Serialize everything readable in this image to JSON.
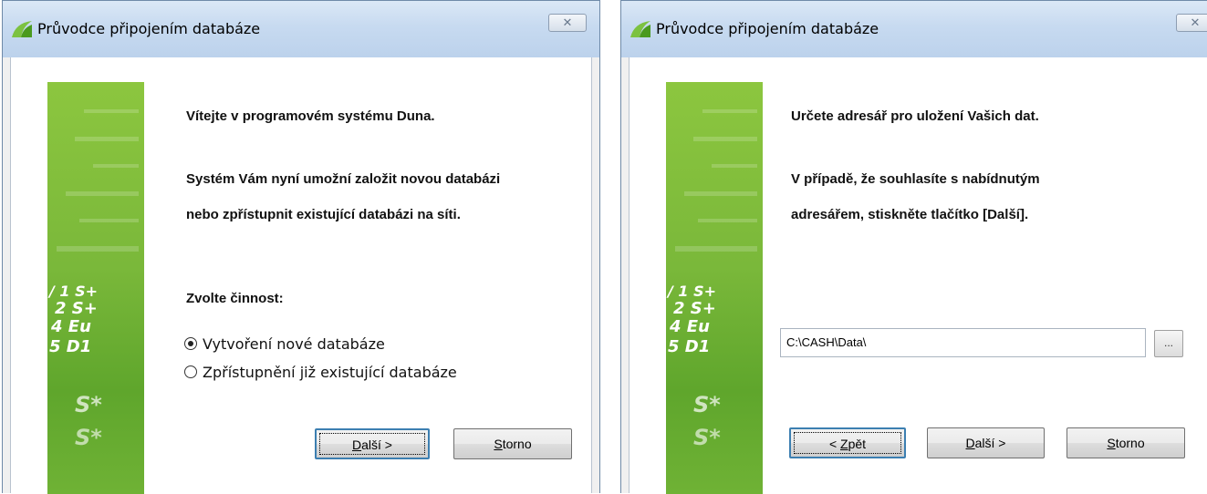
{
  "left_window": {
    "title": "Průvodce připojením databáze",
    "close_glyph": "✕",
    "welcome": "Vítejte v programovém systému Duna.",
    "intro_line1": "Systém Vám nyní umožní založit novou databázi",
    "intro_line2": "nebo zpřístupnit existující databázi na síti.",
    "choose_label": "Zvolte činnost:",
    "options": [
      {
        "label": "Vytvoření nové databáze",
        "checked": true
      },
      {
        "label": "Zpřístupnění již existující databáze",
        "checked": false
      }
    ],
    "next_button": {
      "pre": "",
      "mnemonic": "D",
      "post": "alší >"
    },
    "cancel_button": {
      "pre": "",
      "mnemonic": "S",
      "post": "torno"
    }
  },
  "right_window": {
    "title": "Průvodce připojením databáze",
    "close_glyph": "✕",
    "line1": "Určete adresář pro uložení Vašich dat.",
    "line2": "V případě, že souhlasíte s nabídnutým",
    "line3": "adresářem, stiskněte tlačítko [Další].",
    "path_value": "C:\\CASH\\Data\\",
    "browse_label": "...",
    "back_button": {
      "pre": "< ",
      "mnemonic": "Z",
      "post": "pět"
    },
    "next_button": {
      "pre": "",
      "mnemonic": "D",
      "post": "alší >"
    },
    "cancel_button": {
      "pre": "",
      "mnemonic": "S",
      "post": "torno"
    }
  },
  "banner": {
    "glyph_rows": [
      "/  1  S+",
      "2  S+",
      "4  Eu",
      "5  D1",
      "S*",
      "S*"
    ]
  },
  "colors": {
    "banner_green": "#7cc241",
    "titlebar": "#c7daf0",
    "default_button_border": "#3c7fb1"
  }
}
